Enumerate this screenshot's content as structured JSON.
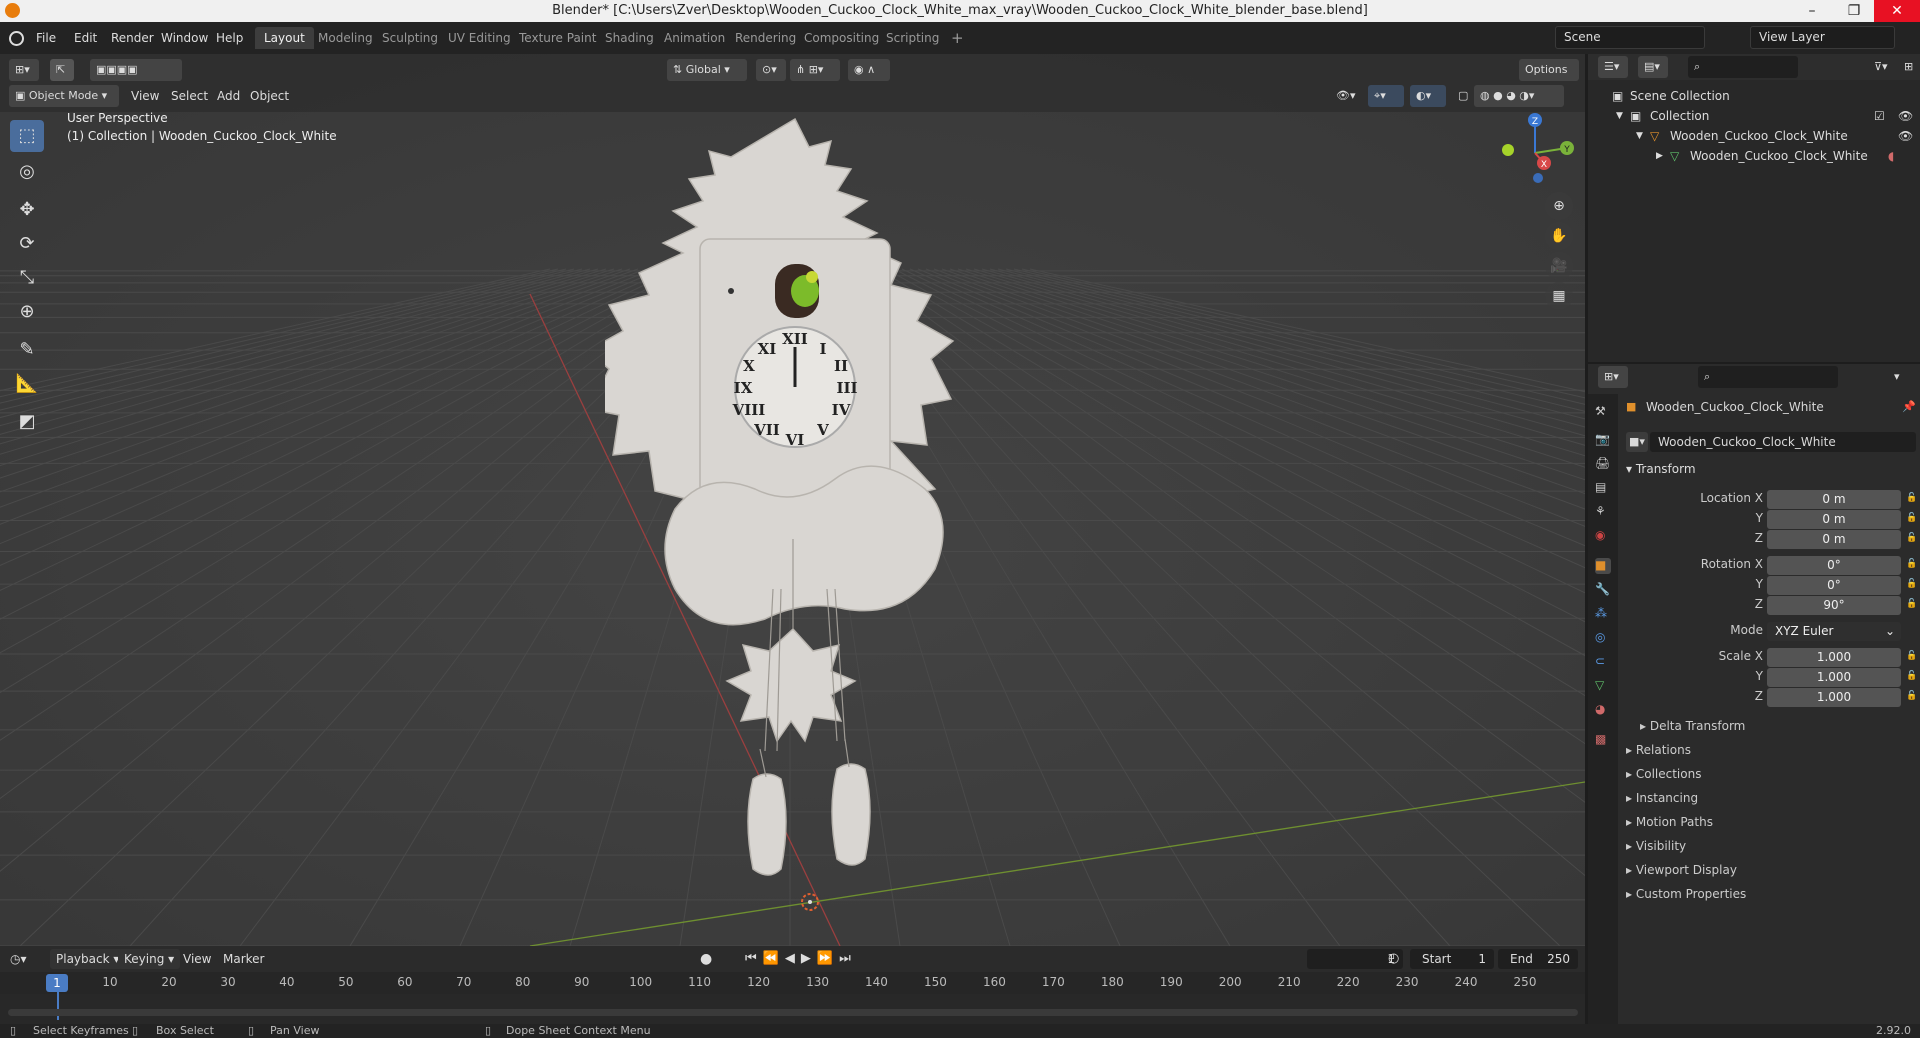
{
  "window": {
    "title": "Blender* [C:\\Users\\Zver\\Desktop\\Wooden_Cuckoo_Clock_White_max_vray\\Wooden_Cuckoo_Clock_White_blender_base.blend]",
    "minimize": "–",
    "maximize": "❐",
    "close": "✕"
  },
  "menu": [
    "File",
    "Edit",
    "Render",
    "Window",
    "Help"
  ],
  "workspaces": [
    "Layout",
    "Modeling",
    "Sculpting",
    "UV Editing",
    "Texture Paint",
    "Shading",
    "Animation",
    "Rendering",
    "Compositing",
    "Scripting"
  ],
  "add_workspace": "+",
  "scene": {
    "name": "Scene",
    "view_layer": "View Layer"
  },
  "viewport": {
    "mode": "Object Mode",
    "menus": [
      "View",
      "Select",
      "Add",
      "Object"
    ],
    "orientation": "Global",
    "options": "Options",
    "perspective": "User Perspective",
    "collection_label": "(1) Collection | Wooden_Cuckoo_Clock_White",
    "gizmo": {
      "x": "X",
      "y": "Y",
      "z": "Z"
    }
  },
  "outliner": {
    "scene_collection": "Scene Collection",
    "collection": "Collection",
    "object": "Wooden_Cuckoo_Clock_White",
    "mesh": "Wooden_Cuckoo_Clock_White"
  },
  "properties": {
    "object_name": "Wooden_Cuckoo_Clock_White",
    "data_name": "Wooden_Cuckoo_Clock_White",
    "transform": "Transform",
    "location_label": "Location X",
    "rotation_label": "Rotation X",
    "scale_label": "Scale X",
    "y": "Y",
    "z": "Z",
    "location": [
      "0 m",
      "0 m",
      "0 m"
    ],
    "rotation": [
      "0°",
      "0°",
      "90°"
    ],
    "mode_label": "Mode",
    "mode_value": "XYZ Euler",
    "scale": [
      "1.000",
      "1.000",
      "1.000"
    ],
    "delta": "Delta Transform",
    "sections": [
      "Relations",
      "Collections",
      "Instancing",
      "Motion Paths",
      "Visibility",
      "Viewport Display",
      "Custom Properties"
    ]
  },
  "timeline": {
    "menus": [
      "Playback",
      "Keying",
      "View",
      "Marker"
    ],
    "current_frame": "1",
    "start_label": "Start",
    "start": "1",
    "end_label": "End",
    "end": "250",
    "ticks": [
      "10",
      "20",
      "30",
      "40",
      "50",
      "60",
      "70",
      "80",
      "90",
      "100",
      "110",
      "120",
      "130",
      "140",
      "150",
      "160",
      "170",
      "180",
      "190",
      "200",
      "210",
      "220",
      "230",
      "240",
      "250"
    ]
  },
  "status": {
    "select": "Select Keyframes",
    "box": "Box Select",
    "pan": "Pan View",
    "context": "Dope Sheet Context Menu",
    "version": "2.92.0"
  }
}
